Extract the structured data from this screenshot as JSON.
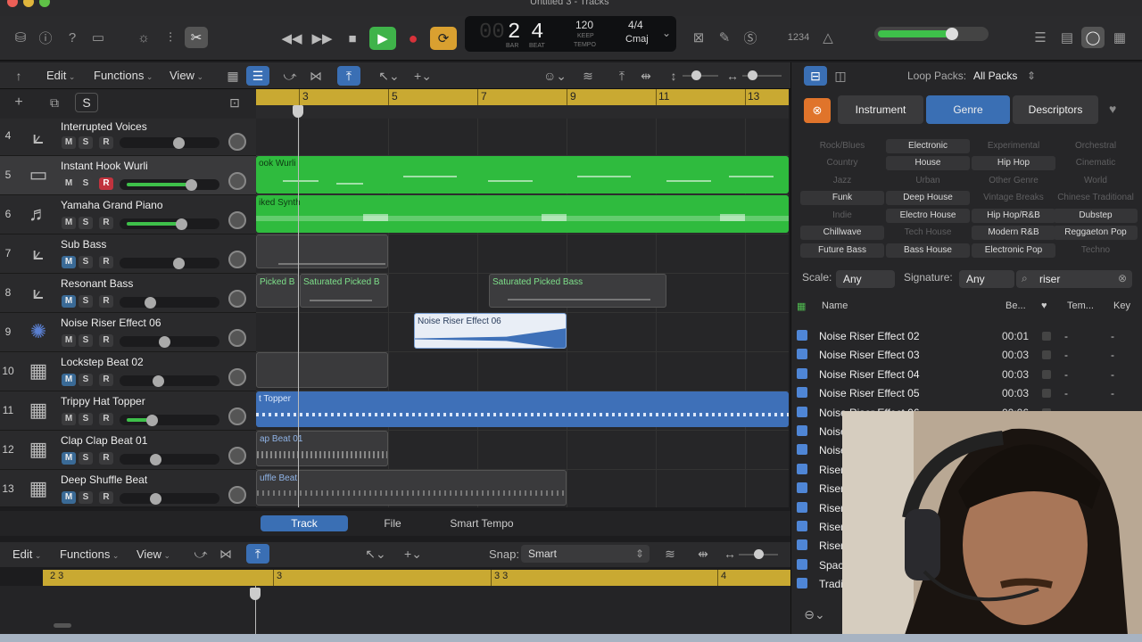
{
  "window": {
    "title": "Untitled 3 - Tracks"
  },
  "lcd": {
    "bar": "2",
    "beat": "4",
    "bar_label": "BAR",
    "beat_label": "BEAT",
    "tempo": "120",
    "keep": "KEEP",
    "tempo_label": "TEMPO",
    "signature": "4/4",
    "key": "Cmaj"
  },
  "toolbar": {
    "counter": "1234"
  },
  "tracks_menu": {
    "edit": "Edit",
    "functions": "Functions",
    "view": "View"
  },
  "track_header": {
    "add": "+",
    "s": "S"
  },
  "ruler": {
    "bars": [
      "3",
      "5",
      "7",
      "9",
      "11",
      "13"
    ]
  },
  "tracks": [
    {
      "num": "4",
      "name": "Interrupted Voices",
      "m": "M",
      "s": "S",
      "r": "R"
    },
    {
      "num": "5",
      "name": "Instant Hook Wurli",
      "m": "M",
      "s": "S",
      "r": "R"
    },
    {
      "num": "6",
      "name": "Yamaha Grand Piano",
      "m": "M",
      "s": "S",
      "r": "R"
    },
    {
      "num": "7",
      "name": "Sub Bass",
      "m": "M",
      "s": "S",
      "r": "R"
    },
    {
      "num": "8",
      "name": "Resonant Bass",
      "m": "M",
      "s": "S",
      "r": "R"
    },
    {
      "num": "9",
      "name": "Noise Riser Effect 06",
      "m": "M",
      "s": "S",
      "r": "R"
    },
    {
      "num": "10",
      "name": "Lockstep Beat 02",
      "m": "M",
      "s": "S",
      "r": "R"
    },
    {
      "num": "11",
      "name": "Trippy Hat Topper",
      "m": "M",
      "s": "S",
      "r": "R"
    },
    {
      "num": "12",
      "name": "Clap Clap Beat 01",
      "m": "M",
      "s": "S",
      "r": "R"
    },
    {
      "num": "13",
      "name": "Deep Shuffle Beat",
      "m": "M",
      "s": "S",
      "r": "R"
    }
  ],
  "regions": {
    "wurli": "ook Wurli",
    "synth": "iked Synth",
    "picked_b": "Picked B",
    "sat1": "Saturated Picked B",
    "sat2": "Saturated Picked Bass",
    "riser": "Noise Riser Effect 06",
    "topper": "t Topper",
    "clap": "ap Beat 01",
    "shuffle": "uffle Beat"
  },
  "bottom_tabs": {
    "track": "Track",
    "file": "File",
    "smart": "Smart Tempo"
  },
  "bottom_menu": {
    "edit": "Edit",
    "functions": "Functions",
    "view": "View",
    "snap_label": "Snap:",
    "snap_value": "Smart"
  },
  "bottom_ruler": {
    "labels": [
      "2 3",
      "3",
      "3 3",
      "4"
    ]
  },
  "loops": {
    "packs_label": "Loop Packs:",
    "packs_value": "All Packs",
    "tabs": {
      "instrument": "Instrument",
      "genre": "Genre",
      "descriptors": "Descriptors"
    },
    "keywords": [
      [
        "Rock/Blues",
        "Electronic",
        "Experimental",
        "Orchestral"
      ],
      [
        "Country",
        "House",
        "Hip Hop",
        "Cinematic"
      ],
      [
        "Jazz",
        "Urban",
        "Other Genre",
        "World"
      ],
      [
        "Funk",
        "Deep House",
        "Vintage Breaks",
        "Chinese Traditional"
      ],
      [
        "Indie",
        "Electro House",
        "Hip Hop/R&B",
        "Dubstep"
      ],
      [
        "Chillwave",
        "Tech House",
        "Modern R&B",
        "Reggaeton Pop"
      ],
      [
        "Future Bass",
        "Bass House",
        "Electronic Pop",
        "Techno"
      ]
    ],
    "scale_label": "Scale:",
    "scale_value": "Any",
    "signature_label": "Signature:",
    "signature_value": "Any",
    "search": "riser",
    "cols": {
      "name": "Name",
      "beats": "Be...",
      "tempo": "Tem...",
      "key": "Key"
    },
    "results": [
      {
        "name": "Noise Riser Effect 02",
        "beats": "00:01",
        "tempo": "-",
        "key": "-"
      },
      {
        "name": "Noise Riser Effect 03",
        "beats": "00:03",
        "tempo": "-",
        "key": "-"
      },
      {
        "name": "Noise Riser Effect 04",
        "beats": "00:03",
        "tempo": "-",
        "key": "-"
      },
      {
        "name": "Noise Riser Effect 05",
        "beats": "00:03",
        "tempo": "-",
        "key": "-"
      },
      {
        "name": "Noise Riser Effect 06",
        "beats": "00:06",
        "tempo": "-",
        "key": "-"
      },
      {
        "name": "Noise",
        "beats": "",
        "tempo": "",
        "key": ""
      },
      {
        "name": "Noise",
        "beats": "",
        "tempo": "",
        "key": ""
      },
      {
        "name": "Riser",
        "beats": "",
        "tempo": "",
        "key": ""
      },
      {
        "name": "Riser",
        "beats": "",
        "tempo": "",
        "key": ""
      },
      {
        "name": "Riser",
        "beats": "",
        "tempo": "",
        "key": ""
      },
      {
        "name": "Riser",
        "beats": "",
        "tempo": "",
        "key": ""
      },
      {
        "name": "Riser",
        "beats": "",
        "tempo": "",
        "key": ""
      },
      {
        "name": "Spac",
        "beats": "",
        "tempo": "",
        "key": ""
      },
      {
        "name": "Tradi",
        "beats": "",
        "tempo": "",
        "key": ""
      }
    ]
  },
  "colors": {
    "accent": "#3a6fb4",
    "midi_green": "#2fbb3e",
    "audio_blue": "#3e70b8",
    "ruler": "#c9a932",
    "record": "#c1333e"
  }
}
